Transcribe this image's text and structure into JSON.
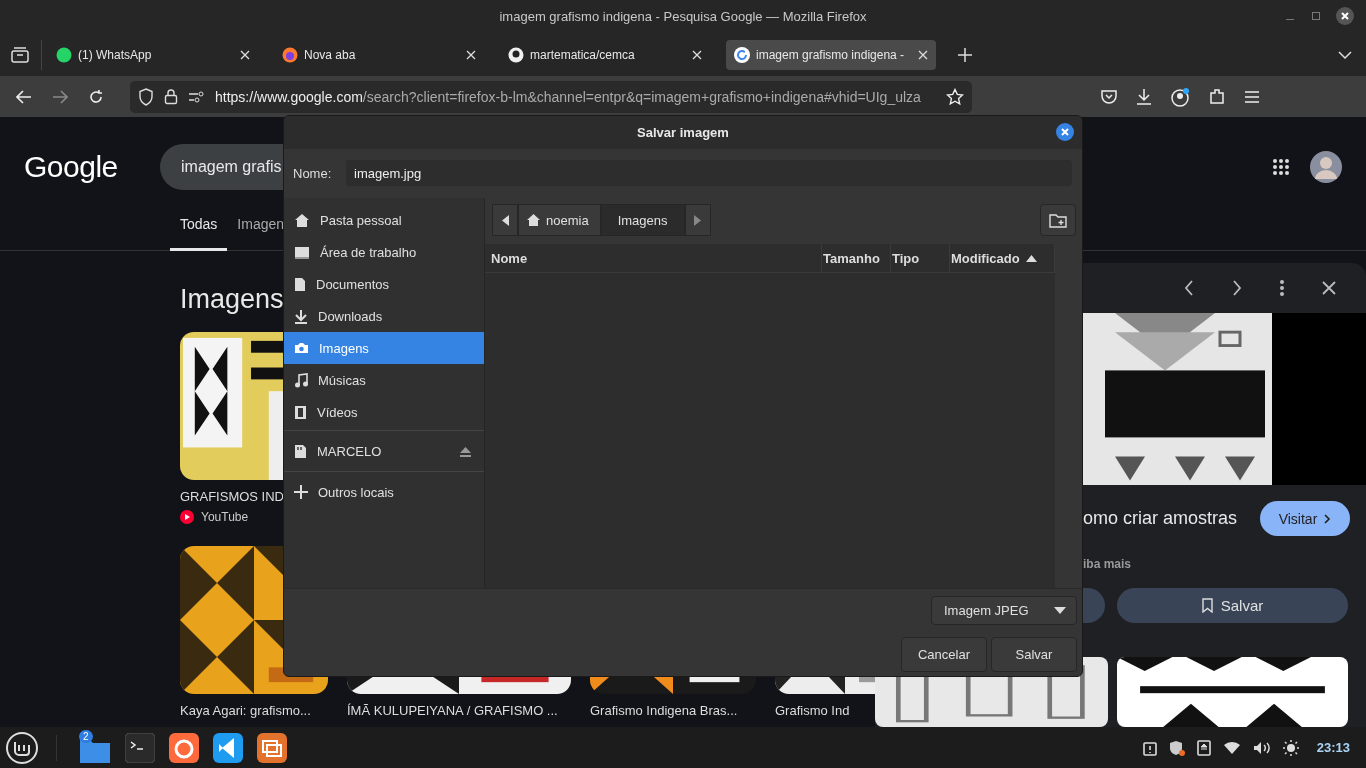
{
  "window": {
    "title": "imagem grafismo indigena - Pesquisa Google — Mozilla Firefox"
  },
  "tabs": [
    {
      "label": "(1) WhatsApp",
      "selected": false
    },
    {
      "label": "Nova aba",
      "selected": false
    },
    {
      "label": "martematica/cemca",
      "selected": false
    },
    {
      "label": "imagem grafismo indigena -",
      "selected": true
    }
  ],
  "address_bar": {
    "url_host": "https://www.google.com",
    "url_rest": "/search?client=firefox-b-lm&channel=entpr&q=imagem+grafismo+indigena#vhid=UIg_ulza"
  },
  "google": {
    "logo": "Google",
    "search_value": "imagem grafis",
    "tabs": [
      {
        "label": "Todas",
        "selected": true
      },
      {
        "label": "Imagen",
        "selected": false
      }
    ],
    "heading": "Imagens",
    "row_1": [
      {
        "caption": "GRAFISMOS IND",
        "source": "YouTube"
      }
    ],
    "row_2": [
      {
        "caption": "Kaya Agari: grafismo..."
      },
      {
        "caption": "ÍMÃ KULUPEIYANA / GRAFISMO ..."
      },
      {
        "caption": "Grafismo Indigena Bras..."
      },
      {
        "caption": "Grafismo Ind"
      }
    ],
    "preview": {
      "title": "omo criar amostras",
      "visit_button": "Visitar",
      "more": "iba mais",
      "save_button": "Salvar"
    }
  },
  "dialog": {
    "title": "Salvar imagem",
    "name_label": "Nome:",
    "name_value": "imagem.jpg",
    "places": [
      {
        "label": "Pasta pessoal",
        "kind": "place",
        "selected": false
      },
      {
        "label": "Área de trabalho",
        "kind": "place",
        "selected": false
      },
      {
        "label": "Documentos",
        "kind": "place",
        "selected": false
      },
      {
        "label": "Downloads",
        "kind": "place",
        "selected": false
      },
      {
        "label": "Imagens",
        "kind": "place",
        "selected": true
      },
      {
        "label": "Músicas",
        "kind": "place",
        "selected": false
      },
      {
        "label": "Vídeos",
        "kind": "place",
        "selected": false
      },
      {
        "label": "MARCELO",
        "kind": "device",
        "selected": false
      },
      {
        "label": "Outros locais",
        "kind": "other",
        "selected": false
      }
    ],
    "path": [
      {
        "label": "noemia",
        "selected": false
      },
      {
        "label": "Imagens",
        "selected": true
      }
    ],
    "columns": [
      {
        "label": "Nome",
        "sorted": false
      },
      {
        "label": "Tamanho",
        "sorted": false
      },
      {
        "label": "Tipo",
        "sorted": false
      },
      {
        "label": "Modificado",
        "sorted": true
      }
    ],
    "file_type": "Imagem JPEG",
    "cancel_button": "Cancelar",
    "save_button": "Salvar"
  },
  "taskbar": {
    "files_badge": "2",
    "clock": "23:13"
  }
}
